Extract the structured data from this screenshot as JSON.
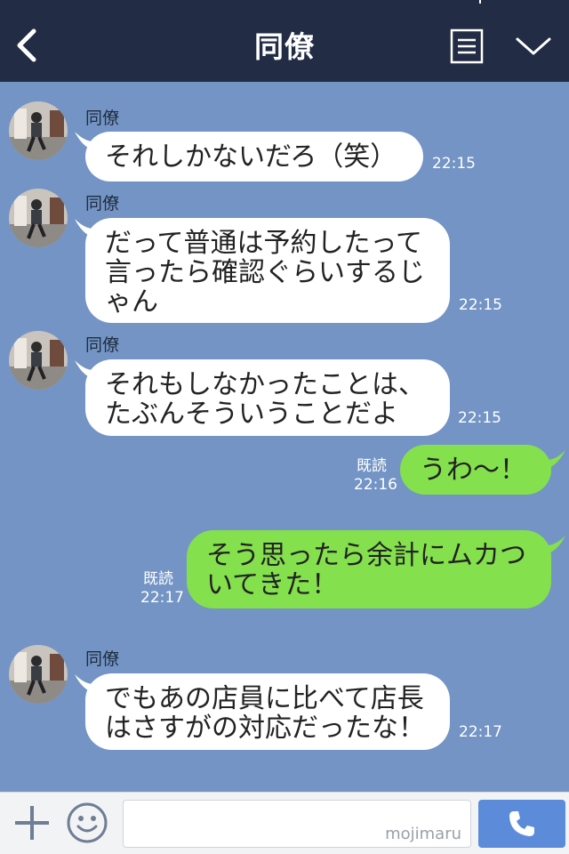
{
  "header": {
    "title": "同僚",
    "back_icon": "chevron-left-icon",
    "menu_icon": "list-icon",
    "expand_icon": "chevron-down-icon"
  },
  "messages": [
    {
      "direction": "in",
      "sender": "同僚",
      "lines": [
        "それしかないだろ（笑）"
      ],
      "time": "22:15"
    },
    {
      "direction": "in",
      "sender": "同僚",
      "lines": [
        "だって普通は予約したって",
        "言ったら確認ぐらいするじ",
        "ゃん"
      ],
      "time": "22:15"
    },
    {
      "direction": "in",
      "sender": "同僚",
      "lines": [
        "それもしなかったことは、",
        "たぶんそういうことだよ"
      ],
      "time": "22:15"
    },
    {
      "direction": "out",
      "read": "既読",
      "lines": [
        "うわ〜！"
      ],
      "time": "22:16"
    },
    {
      "direction": "out",
      "read": "既読",
      "lines": [
        "そう思ったら余計にムカつ",
        "いてきた！"
      ],
      "time": "22:17"
    },
    {
      "direction": "in",
      "sender": "同僚",
      "lines": [
        "でもあの店員に比べて店長",
        "はさすがの対応だったな！"
      ],
      "time": "22:17"
    }
  ],
  "footer": {
    "watermark": "mojimaru",
    "plus_icon": "plus-icon",
    "emoji_icon": "smile-icon",
    "call_icon": "phone-icon"
  },
  "colors": {
    "header_bg": "#222c44",
    "chat_bg": "#7394c4",
    "incoming_bubble": "#ffffff",
    "outgoing_bubble": "#84e04d",
    "call_button": "#5b8bd9"
  }
}
